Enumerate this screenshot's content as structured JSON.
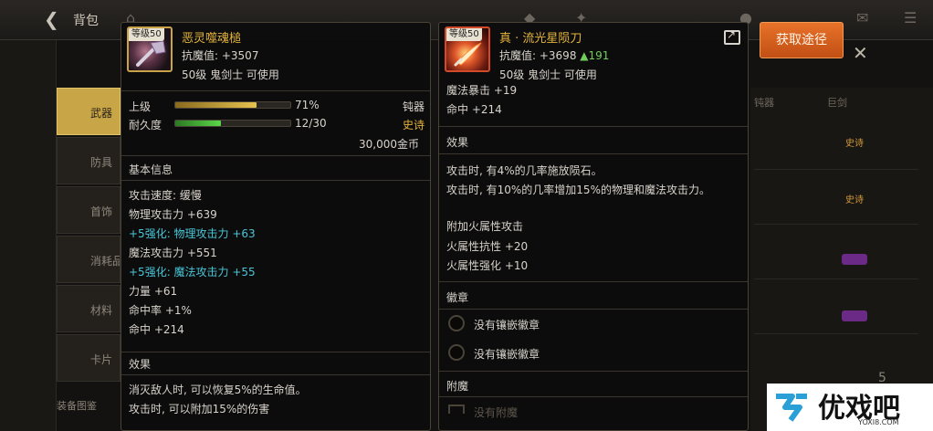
{
  "background": {
    "title": "背包",
    "tabs": [
      "武器",
      "防具",
      "首饰",
      "消耗品",
      "材料",
      "卡片"
    ],
    "active_tab_index": 0,
    "bottom_label": "装备图鉴",
    "right_headers": [
      "钝器",
      "巨剑"
    ],
    "right_rows": [
      {
        "badge": "史诗",
        "kind": "epic"
      },
      {
        "badge": "史诗",
        "kind": "epic"
      },
      {
        "badge": "",
        "kind": "purple"
      },
      {
        "badge": "",
        "kind": "purple"
      }
    ],
    "bottom_number": "5"
  },
  "acquire_button": {
    "label": "获取途径"
  },
  "left_item": {
    "level_tag": "等级50",
    "name": "恶灵噬魂槌",
    "magic_resist": "抗魔值: +3507",
    "requirement": "50级 鬼剑士 可使用",
    "grade_label": "上级",
    "grade_percent_text": "71%",
    "grade_fill": 0.71,
    "weapon_type": "钝器",
    "durability_label": "耐久度",
    "durability_text": "12/30",
    "durability_fill": 0.4,
    "rarity": "史诗",
    "price": "30,000金币",
    "basic_info_title": "基本信息",
    "stats": [
      {
        "text": "攻击速度: 缓慢",
        "style": "normal"
      },
      {
        "text": "物理攻击力 +639",
        "style": "normal"
      },
      {
        "text": "+5强化: 物理攻击力 +63",
        "style": "cyan"
      },
      {
        "text": "魔法攻击力 +551",
        "style": "normal"
      },
      {
        "text": "+5强化: 魔法攻击力 +55",
        "style": "cyan"
      },
      {
        "text": "力量 +61",
        "style": "normal"
      },
      {
        "text": "命中率 +1%",
        "style": "normal"
      },
      {
        "text": "命中 +214",
        "style": "normal"
      }
    ],
    "effect_title": "效果",
    "effects": [
      "消灭敌人时, 可以恢复5%的生命值。",
      "攻击时, 可以附加15%的伤害"
    ]
  },
  "right_item": {
    "level_tag": "等级50",
    "name": "真 · 流光星陨刀",
    "magic_resist_prefix": "抗魔值: +3698",
    "magic_resist_up": "▲191",
    "requirement": "50级 鬼剑士 可使用",
    "stats": [
      "魔法暴击 +19",
      "命中 +214"
    ],
    "effect_title": "效果",
    "effects": [
      "攻击时, 有4%的几率施放陨石。",
      "攻击时, 有10%的几率增加15%的物理和魔法攻击力。"
    ],
    "element_lines": [
      "附加火属性攻击",
      "火属性抗性 +20",
      "火属性强化 +10"
    ],
    "emblem_title": "徽章",
    "emblem_slots": [
      "没有镶嵌徽章",
      "没有镶嵌徽章"
    ],
    "enchant_title": "附魔",
    "enchant_partial": "没有附魔"
  },
  "watermark": {
    "brand": "优戏吧",
    "domain": "YOXI8.COM"
  }
}
